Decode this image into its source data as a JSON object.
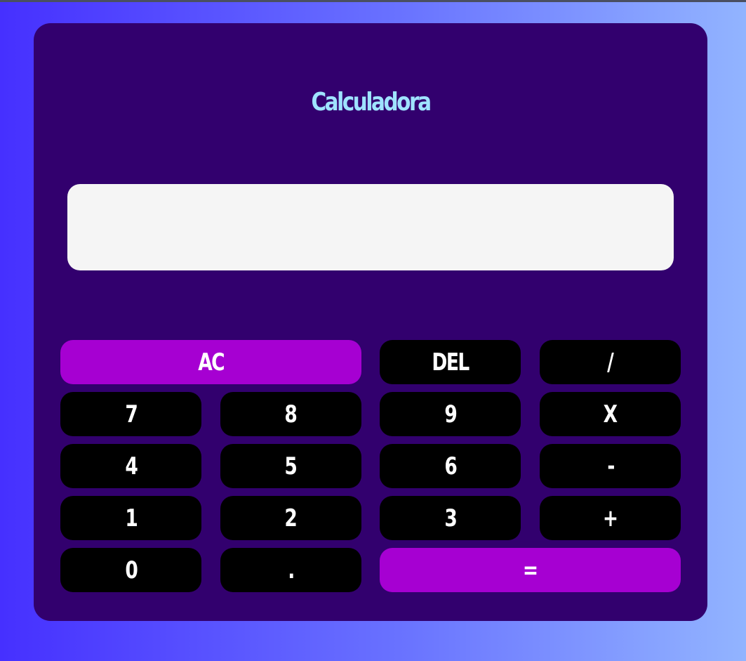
{
  "app": {
    "title": "Calculadora",
    "display_value": "",
    "colors": {
      "background_gradient_start": "#4630ff",
      "background_gradient_end": "#92b4ff",
      "panel": "#32006e",
      "title": "#9fe3ff",
      "display": "#f5f5f5",
      "key": "#000000",
      "key_accent": "#a600d2",
      "key_text": "#ffffff"
    }
  },
  "keys": {
    "ac": "AC",
    "del": "DEL",
    "divide": "/",
    "seven": "7",
    "eight": "8",
    "nine": "9",
    "multiply": "X",
    "four": "4",
    "five": "5",
    "six": "6",
    "minus": "-",
    "one": "1",
    "two": "2",
    "three": "3",
    "plus": "+",
    "zero": "0",
    "dot": ".",
    "equals": "="
  }
}
